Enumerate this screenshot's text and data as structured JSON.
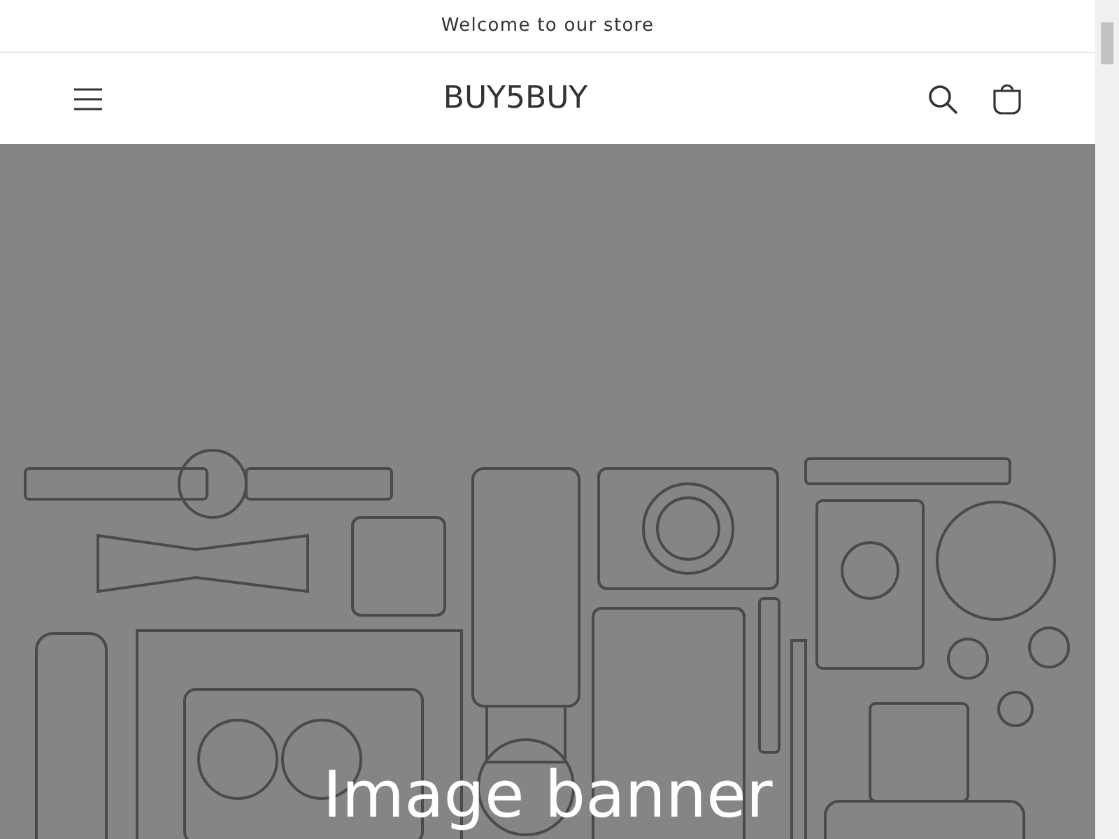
{
  "announcement": {
    "text": "Welcome to our store"
  },
  "header": {
    "logo": "BUY5BUY"
  },
  "banner": {
    "heading": "Image banner"
  }
}
